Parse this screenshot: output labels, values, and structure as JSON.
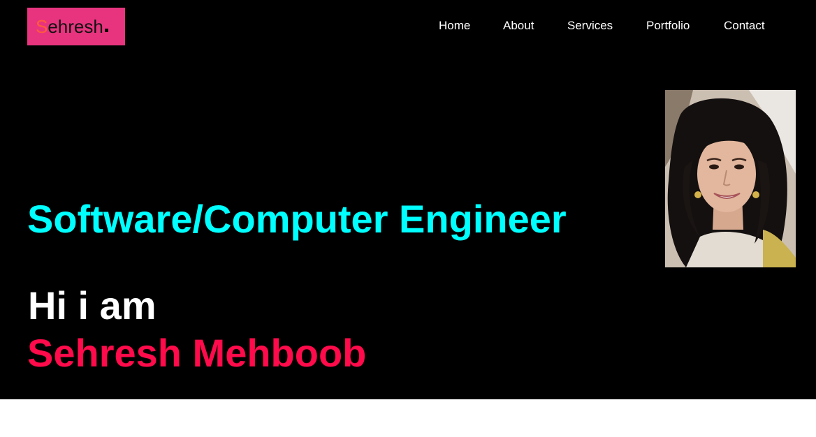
{
  "logo": {
    "first_letter": "S",
    "rest": "ehresh"
  },
  "nav": {
    "items": [
      {
        "label": "Home"
      },
      {
        "label": "About"
      },
      {
        "label": "Services"
      },
      {
        "label": "Portfolio"
      },
      {
        "label": "Contact"
      }
    ]
  },
  "hero": {
    "profession": "Software/Computer Engineer",
    "greeting": "Hi i am",
    "name": "Sehresh Mehboob"
  },
  "colors": {
    "background": "#000000",
    "logo_bg": "#e8347f",
    "profession": "#00ffff",
    "name": "#ff0a4a"
  }
}
